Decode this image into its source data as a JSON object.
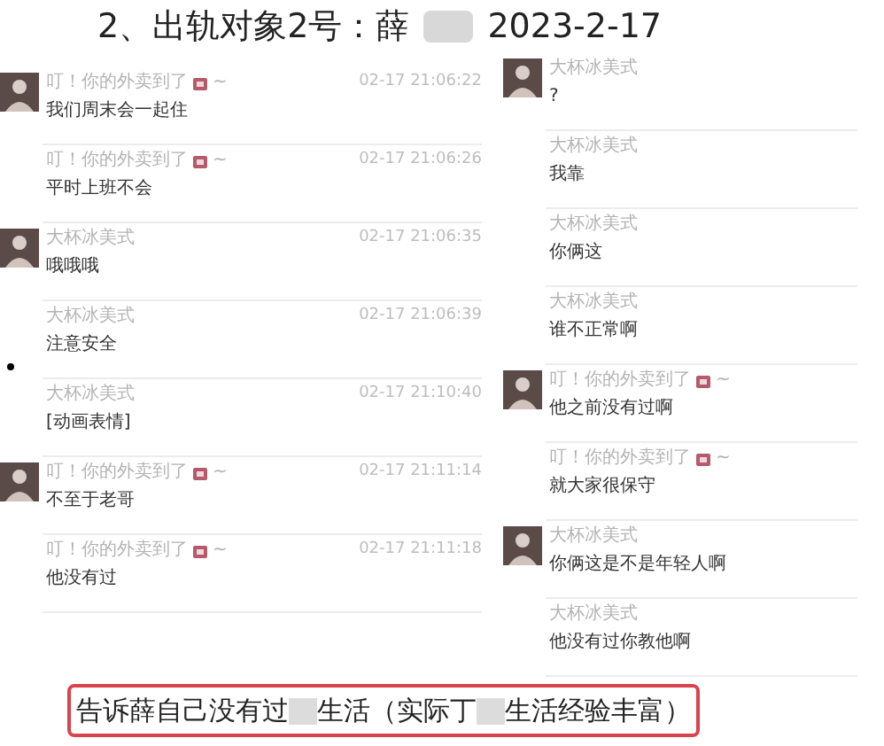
{
  "title": [
    {
      "kind": "text",
      "text": "2、出轨对象2号：薛"
    },
    {
      "kind": "blur"
    },
    {
      "kind": "text",
      "text": "2023-2-17"
    }
  ],
  "left_chat": [
    {
      "sender": "叮！你的外卖到了",
      "suffix": "~",
      "emoji": true,
      "avatar": true,
      "time": "02-17 21:06:22",
      "text": "我们周末会一起住"
    },
    {
      "sender": "叮！你的外卖到了",
      "suffix": "~",
      "emoji": true,
      "avatar": false,
      "time": "02-17 21:06:26",
      "text": "平时上班不会"
    },
    {
      "sender": "大杯冰美式",
      "emoji": false,
      "avatar": true,
      "time": "02-17 21:06:35",
      "text": "哦哦哦"
    },
    {
      "sender": "大杯冰美式",
      "emoji": false,
      "avatar": false,
      "time": "02-17 21:06:39",
      "text": "注意安全"
    },
    {
      "sender": "大杯冰美式",
      "emoji": false,
      "avatar": false,
      "time": "02-17 21:10:40",
      "text": "[动画表情]"
    },
    {
      "sender": "叮！你的外卖到了",
      "suffix": "~",
      "emoji": true,
      "avatar": true,
      "time": "02-17 21:11:14",
      "text": "不至于老哥"
    },
    {
      "sender": "叮！你的外卖到了",
      "suffix": "~",
      "emoji": true,
      "avatar": false,
      "time": "02-17 21:11:18",
      "text": "他没有过"
    }
  ],
  "right_chat": [
    {
      "sender": "大杯冰美式",
      "emoji": false,
      "avatar": true,
      "text": "?"
    },
    {
      "sender": "大杯冰美式",
      "emoji": false,
      "avatar": false,
      "text": "我靠"
    },
    {
      "sender": "大杯冰美式",
      "emoji": false,
      "avatar": false,
      "text": "你俩这"
    },
    {
      "sender": "大杯冰美式",
      "emoji": false,
      "avatar": false,
      "text": "谁不正常啊"
    },
    {
      "sender": "叮！你的外卖到了",
      "suffix": "~",
      "emoji": true,
      "avatar": true,
      "text": "他之前没有过啊"
    },
    {
      "sender": "叮！你的外卖到了",
      "suffix": "~",
      "emoji": true,
      "avatar": false,
      "text": "就大家很保守"
    },
    {
      "sender": "大杯冰美式",
      "emoji": false,
      "avatar": true,
      "text": "你俩这是不是年轻人啊"
    },
    {
      "sender": "大杯冰美式",
      "emoji": false,
      "avatar": false,
      "text": "他没有过你教他啊"
    }
  ],
  "caption": [
    {
      "kind": "text",
      "text": "告诉薛自己没有过"
    },
    {
      "kind": "blur"
    },
    {
      "kind": "text",
      "text": "生活（实际丁"
    },
    {
      "kind": "blur"
    },
    {
      "kind": "text",
      "text": "生活经验丰富）"
    }
  ]
}
